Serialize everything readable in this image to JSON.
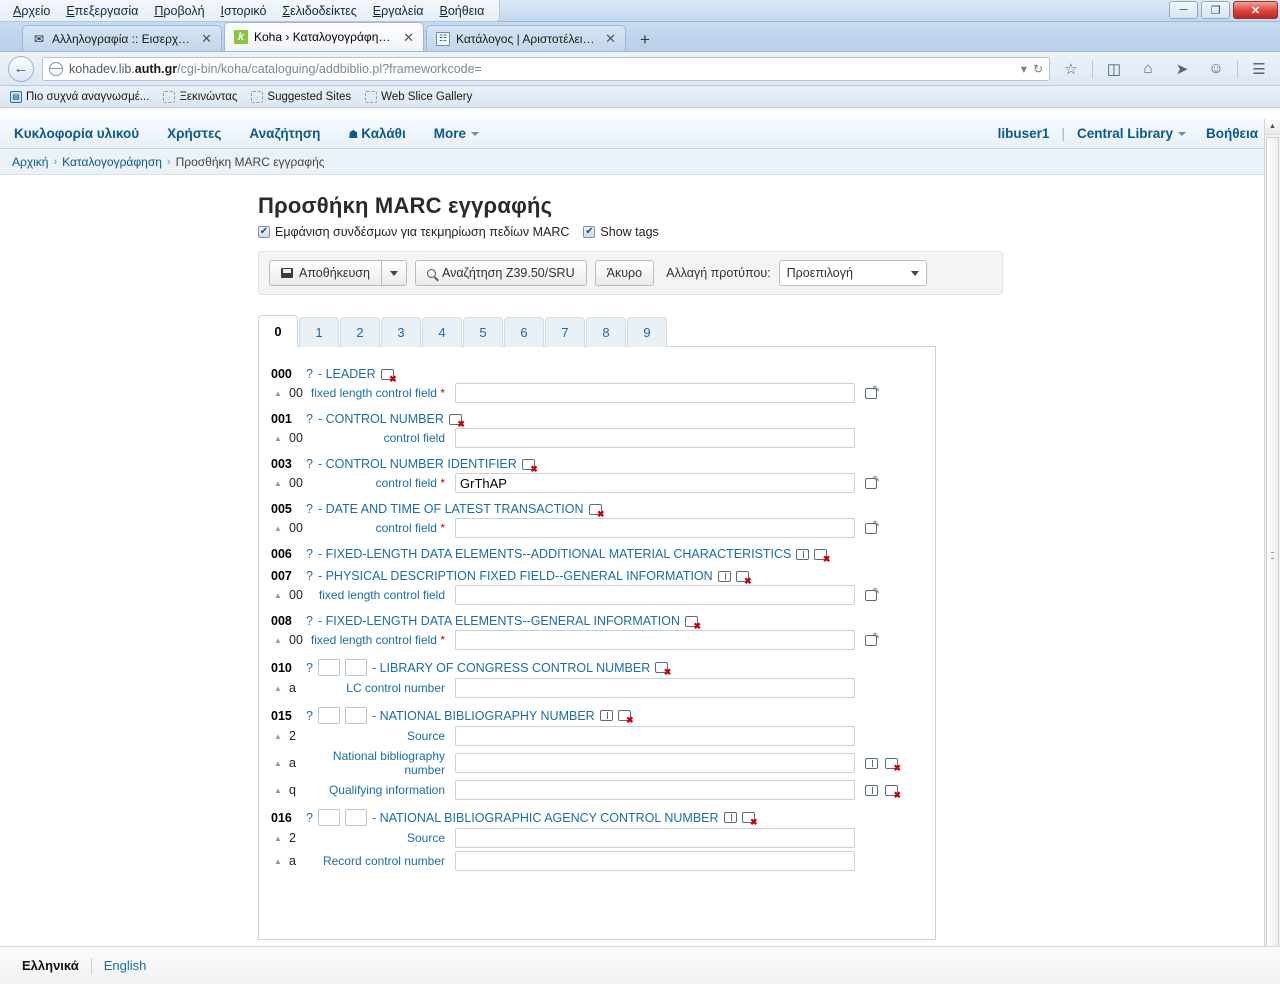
{
  "window": {
    "title": "",
    "menu": [
      "Αρχείο",
      "Επεξεργασία",
      "Προβολή",
      "Ιστορικό",
      "Σελιδοδείκτες",
      "Εργαλεία",
      "Βοήθεια"
    ],
    "buttons": {
      "minimize": "─",
      "restore": "❐",
      "close": "✕"
    }
  },
  "browser": {
    "tabs": [
      {
        "title": "Αλληλογραφία :: Εισερχόμ...",
        "favicon": "mail-icon",
        "favicon_glyph": "✉",
        "active": false
      },
      {
        "title": "Koha › Καταλογογράφηση ...",
        "favicon": "koha-icon",
        "favicon_glyph": "k",
        "active": true
      },
      {
        "title": "Κατάλογος | Αριστοτέλειο ...",
        "favicon": "catalog-icon",
        "favicon_glyph": "☷",
        "active": false
      }
    ],
    "new_tab_label": "+",
    "close_tab_label": "✕",
    "back_label": "←",
    "url": {
      "prefix": "kohadev.lib.",
      "domain": "auth.gr",
      "path": "/cgi-bin/koha/cataloguing/addbiblio.pl?frameworkcode=",
      "full": "kohadev.lib.auth.gr/cgi-bin/koha/cataloguing/addbiblio.pl?frameworkcode="
    },
    "url_right_icons": [
      "dropdown-marker",
      "reload-icon"
    ],
    "nav_icons": [
      "bookmark-star-icon",
      "reader-list-icon",
      "home-icon",
      "send-icon",
      "chat-icon",
      "menu-hamburger-icon"
    ],
    "bookmarks": [
      {
        "label": "Πιο συχνά αναγνωσμέ...",
        "icon": "most-visited-icon"
      },
      {
        "label": "Ξεκινώντας",
        "icon": "folder-icon"
      },
      {
        "label": "Suggested Sites",
        "icon": "folder-icon"
      },
      {
        "label": "Web Slice Gallery",
        "icon": "folder-icon"
      }
    ]
  },
  "koha_nav": {
    "left": [
      {
        "label": "Κυκλοφορία υλικού"
      },
      {
        "label": "Χρήστες"
      },
      {
        "label": "Αναζήτηση"
      },
      {
        "label": "Καλάθι",
        "icon": "cart-icon",
        "icon_glyph": "Ὥ2"
      },
      {
        "label": "More",
        "caret": true
      }
    ],
    "user": "libuser1",
    "separator": "|",
    "branch": "Central Library",
    "help": "Βοήθεια"
  },
  "breadcrumb": {
    "items": [
      "Αρχική",
      "Καταλογογράφηση",
      "Προσθήκη MARC εγγραφής"
    ],
    "separator": "›"
  },
  "page": {
    "title": "Προσθήκη MARC εγγραφής",
    "checkboxes": [
      {
        "label": "Εμφάνιση συνδέσμων για τεκμηρίωση πεδίων MARC",
        "checked": true
      },
      {
        "label": "Show tags",
        "checked": true
      }
    ]
  },
  "toolbar": {
    "save_label": "Αποθήκευση",
    "save_dropdown_label": "▼",
    "z3950_label": "Αναζήτηση Z39.50/SRU",
    "cancel_label": "Άκυρο",
    "framework_label": "Αλλαγή προτύπου:",
    "framework_value": "Προεπιλογή"
  },
  "marc_tabs": {
    "items": [
      "0",
      "1",
      "2",
      "3",
      "4",
      "5",
      "6",
      "7",
      "8",
      "9"
    ],
    "active": "0"
  },
  "marc_fields": [
    {
      "tag": "000",
      "question": "?",
      "dash": "-",
      "description": "LEADER",
      "indicators": false,
      "icons": [
        "delete-icon"
      ],
      "subfields": [
        {
          "code": "00",
          "label": "fixed length control field",
          "required": true,
          "value": "",
          "tools": [
            "edit-icon"
          ]
        }
      ]
    },
    {
      "tag": "001",
      "question": "?",
      "dash": "-",
      "description": "CONTROL NUMBER",
      "indicators": false,
      "icons": [
        "delete-icon"
      ],
      "subfields": [
        {
          "code": "00",
          "label": "control field",
          "required": false,
          "value": "",
          "tools": []
        }
      ]
    },
    {
      "tag": "003",
      "question": "?",
      "dash": "-",
      "description": "CONTROL NUMBER IDENTIFIER",
      "indicators": false,
      "icons": [
        "delete-icon"
      ],
      "subfields": [
        {
          "code": "00",
          "label": "control field",
          "required": true,
          "value": "GrThAP",
          "tools": [
            "edit-icon"
          ]
        }
      ]
    },
    {
      "tag": "005",
      "question": "?",
      "dash": "-",
      "description": "DATE AND TIME OF LATEST TRANSACTION",
      "indicators": false,
      "icons": [
        "delete-icon"
      ],
      "subfields": [
        {
          "code": "00",
          "label": "control field",
          "required": true,
          "value": "",
          "tools": [
            "edit-icon"
          ]
        }
      ]
    },
    {
      "tag": "006",
      "question": "?",
      "dash": "-",
      "description": "FIXED-LENGTH DATA ELEMENTS--ADDITIONAL MATERIAL CHARACTERISTICS",
      "indicators": false,
      "icons": [
        "clone-icon",
        "delete-icon"
      ],
      "subfields": []
    },
    {
      "tag": "007",
      "question": "?",
      "dash": "-",
      "description": "PHYSICAL DESCRIPTION FIXED FIELD--GENERAL INFORMATION",
      "indicators": false,
      "icons": [
        "clone-icon",
        "delete-icon"
      ],
      "subfields": [
        {
          "code": "00",
          "label": "fixed length control field",
          "required": false,
          "value": "",
          "tools": [
            "edit-icon"
          ]
        }
      ]
    },
    {
      "tag": "008",
      "question": "?",
      "dash": "-",
      "description": "FIXED-LENGTH DATA ELEMENTS--GENERAL INFORMATION",
      "indicators": false,
      "icons": [
        "delete-icon"
      ],
      "subfields": [
        {
          "code": "00",
          "label": "fixed length control field",
          "required": true,
          "value": "",
          "tools": [
            "edit-icon"
          ]
        }
      ]
    },
    {
      "tag": "010",
      "question": "?",
      "dash": "-",
      "description": "LIBRARY OF CONGRESS CONTROL NUMBER",
      "indicators": true,
      "indicator_values": [
        "",
        ""
      ],
      "icons": [
        "delete-icon"
      ],
      "subfields": [
        {
          "code": "a",
          "label": "LC control number",
          "required": false,
          "value": "",
          "tools": []
        }
      ]
    },
    {
      "tag": "015",
      "question": "?",
      "dash": "-",
      "description": "NATIONAL BIBLIOGRAPHY NUMBER",
      "indicators": true,
      "indicator_values": [
        "",
        ""
      ],
      "icons": [
        "clone-icon",
        "delete-icon"
      ],
      "subfields": [
        {
          "code": "2",
          "label": "Source",
          "required": false,
          "value": "",
          "tools": []
        },
        {
          "code": "a",
          "label": "National bibliography number",
          "required": false,
          "value": "",
          "tools": [
            "clone-icon",
            "delete-icon"
          ]
        },
        {
          "code": "q",
          "label": "Qualifying information",
          "required": false,
          "value": "",
          "tools": [
            "clone-icon",
            "delete-icon"
          ]
        }
      ]
    },
    {
      "tag": "016",
      "question": "?",
      "dash": "-",
      "description": "NATIONAL BIBLIOGRAPHIC AGENCY CONTROL NUMBER",
      "indicators": true,
      "indicator_values": [
        "",
        ""
      ],
      "icons": [
        "clone-icon",
        "delete-icon"
      ],
      "subfields": [
        {
          "code": "2",
          "label": "Source",
          "required": false,
          "value": "",
          "tools": []
        },
        {
          "code": "a",
          "label": "Record control number",
          "required": false,
          "value": "",
          "tools": []
        }
      ]
    }
  ],
  "language_bar": {
    "current": "Ελληνικά",
    "other": "English"
  },
  "colors": {
    "link": "#1b6ca8",
    "nav_link": "#0b5a8e",
    "required": "#cc0000",
    "koha_green": "#8ac53e",
    "close_red": "#d9453a"
  }
}
